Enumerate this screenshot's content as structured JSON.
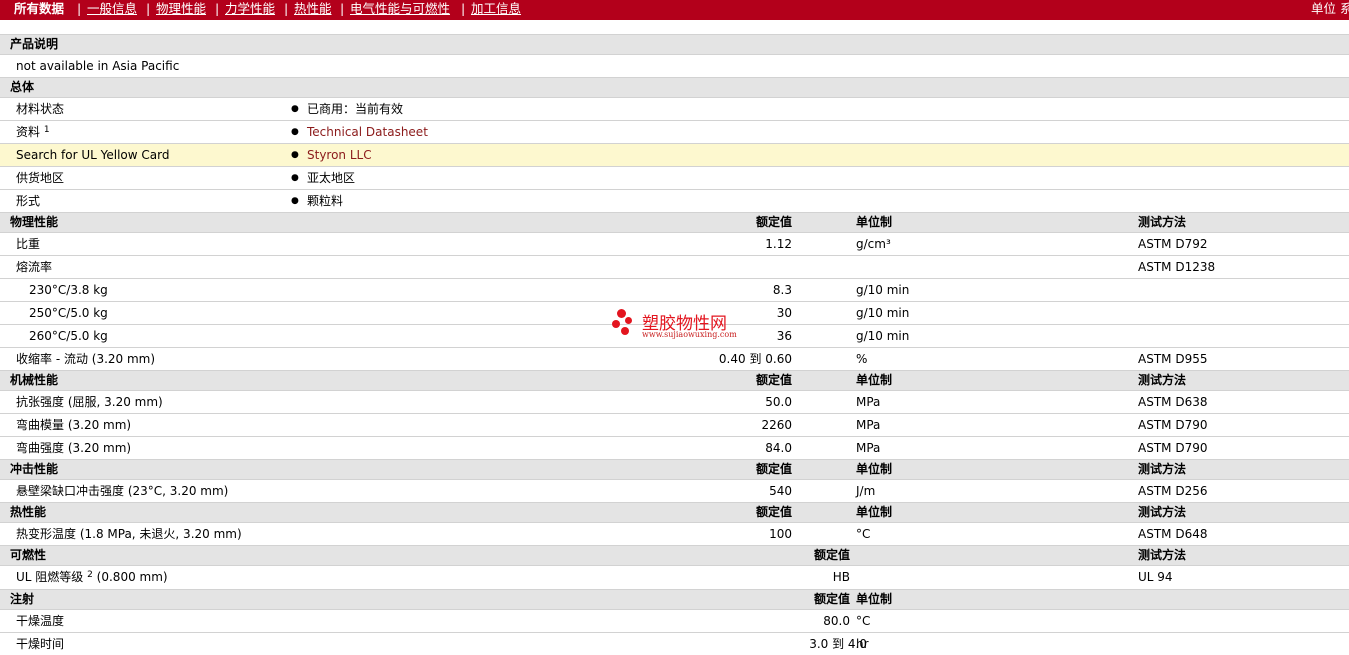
{
  "nav": {
    "tabs": [
      "所有数据",
      "一般信息",
      "物理性能",
      "力学性能",
      "热性能",
      "电气性能与可燃性",
      "加工信息"
    ],
    "unit_label": "单位 系"
  },
  "headers": {
    "nominal": "额定值",
    "unit_system": "单位制",
    "test_method": "测试方法"
  },
  "product_description": {
    "title": "产品说明",
    "text": "not available in Asia Pacific"
  },
  "general": {
    "title": "总体",
    "rows": [
      {
        "label": "材料状态",
        "value": "已商用：当前有效",
        "link": false
      },
      {
        "label": "资料",
        "sup": "1",
        "value": "Technical Datasheet",
        "link": true
      },
      {
        "label": "Search for UL Yellow Card",
        "value": "Styron LLC",
        "link": true,
        "highlight": true
      },
      {
        "label": "供货地区",
        "value": "亚太地区",
        "link": false
      },
      {
        "label": "形式",
        "value": "颗粒料",
        "link": false
      }
    ]
  },
  "physical": {
    "title": "物理性能",
    "rows": [
      {
        "label": "比重",
        "value": "1.12",
        "unit": "g/cm³",
        "method": "ASTM D792"
      },
      {
        "label": "熔流率",
        "value": "",
        "unit": "",
        "method": "ASTM D1238"
      },
      {
        "label": "230°C/3.8 kg",
        "value": "8.3",
        "unit": "g/10 min",
        "method": "",
        "indent": true
      },
      {
        "label": "250°C/5.0 kg",
        "value": "30",
        "unit": "g/10 min",
        "method": "",
        "indent": true
      },
      {
        "label": "260°C/5.0 kg",
        "value": "36",
        "unit": "g/10 min",
        "method": "",
        "indent": true
      },
      {
        "label": "收缩率  - 流动  (3.20 mm)",
        "value": "0.40 到  0.60",
        "unit": "%",
        "method": "ASTM D955"
      }
    ]
  },
  "mechanical": {
    "title": "机械性能",
    "rows": [
      {
        "label": "抗张强度  (屈服, 3.20 mm)",
        "value": "50.0",
        "unit": "MPa",
        "method": "ASTM D638"
      },
      {
        "label": "弯曲模量  (3.20 mm)",
        "value": "2260",
        "unit": "MPa",
        "method": "ASTM D790"
      },
      {
        "label": "弯曲强度  (3.20 mm)",
        "value": "84.0",
        "unit": "MPa",
        "method": "ASTM D790"
      }
    ]
  },
  "impact": {
    "title": "冲击性能",
    "rows": [
      {
        "label": "悬壁梁缺口冲击强度  (23°C, 3.20 mm)",
        "value": "540",
        "unit": "J/m",
        "method": "ASTM D256"
      }
    ]
  },
  "thermal": {
    "title": "热性能",
    "rows": [
      {
        "label": "热变形温度  (1.8 MPa, 未退火, 3.20 mm)",
        "value": "100",
        "unit": "°C",
        "method": "ASTM D648"
      }
    ]
  },
  "flammability": {
    "title": "可燃性",
    "rows": [
      {
        "label": "UL 阻燃等级",
        "sup": "2",
        "suffix": " (0.800 mm)",
        "value": "HB",
        "unit": "",
        "method": "UL 94"
      }
    ]
  },
  "injection": {
    "title": "注射",
    "rows": [
      {
        "label": "干燥温度",
        "value": "80.0",
        "unit": "°C",
        "method": ""
      },
      {
        "label": "干燥时间",
        "value": "3.0 到  4.0",
        "unit": "hr",
        "method": ""
      }
    ]
  },
  "watermark": {
    "name": "塑胶物性网",
    "url": "www.sujiaowuxing.com",
    "color": "#e3151f"
  },
  "colors": {
    "brand": "#b3001b",
    "section_bg": "#e4e4e4",
    "highlight": "#fdf8cf",
    "link": "#8b1a1a"
  }
}
